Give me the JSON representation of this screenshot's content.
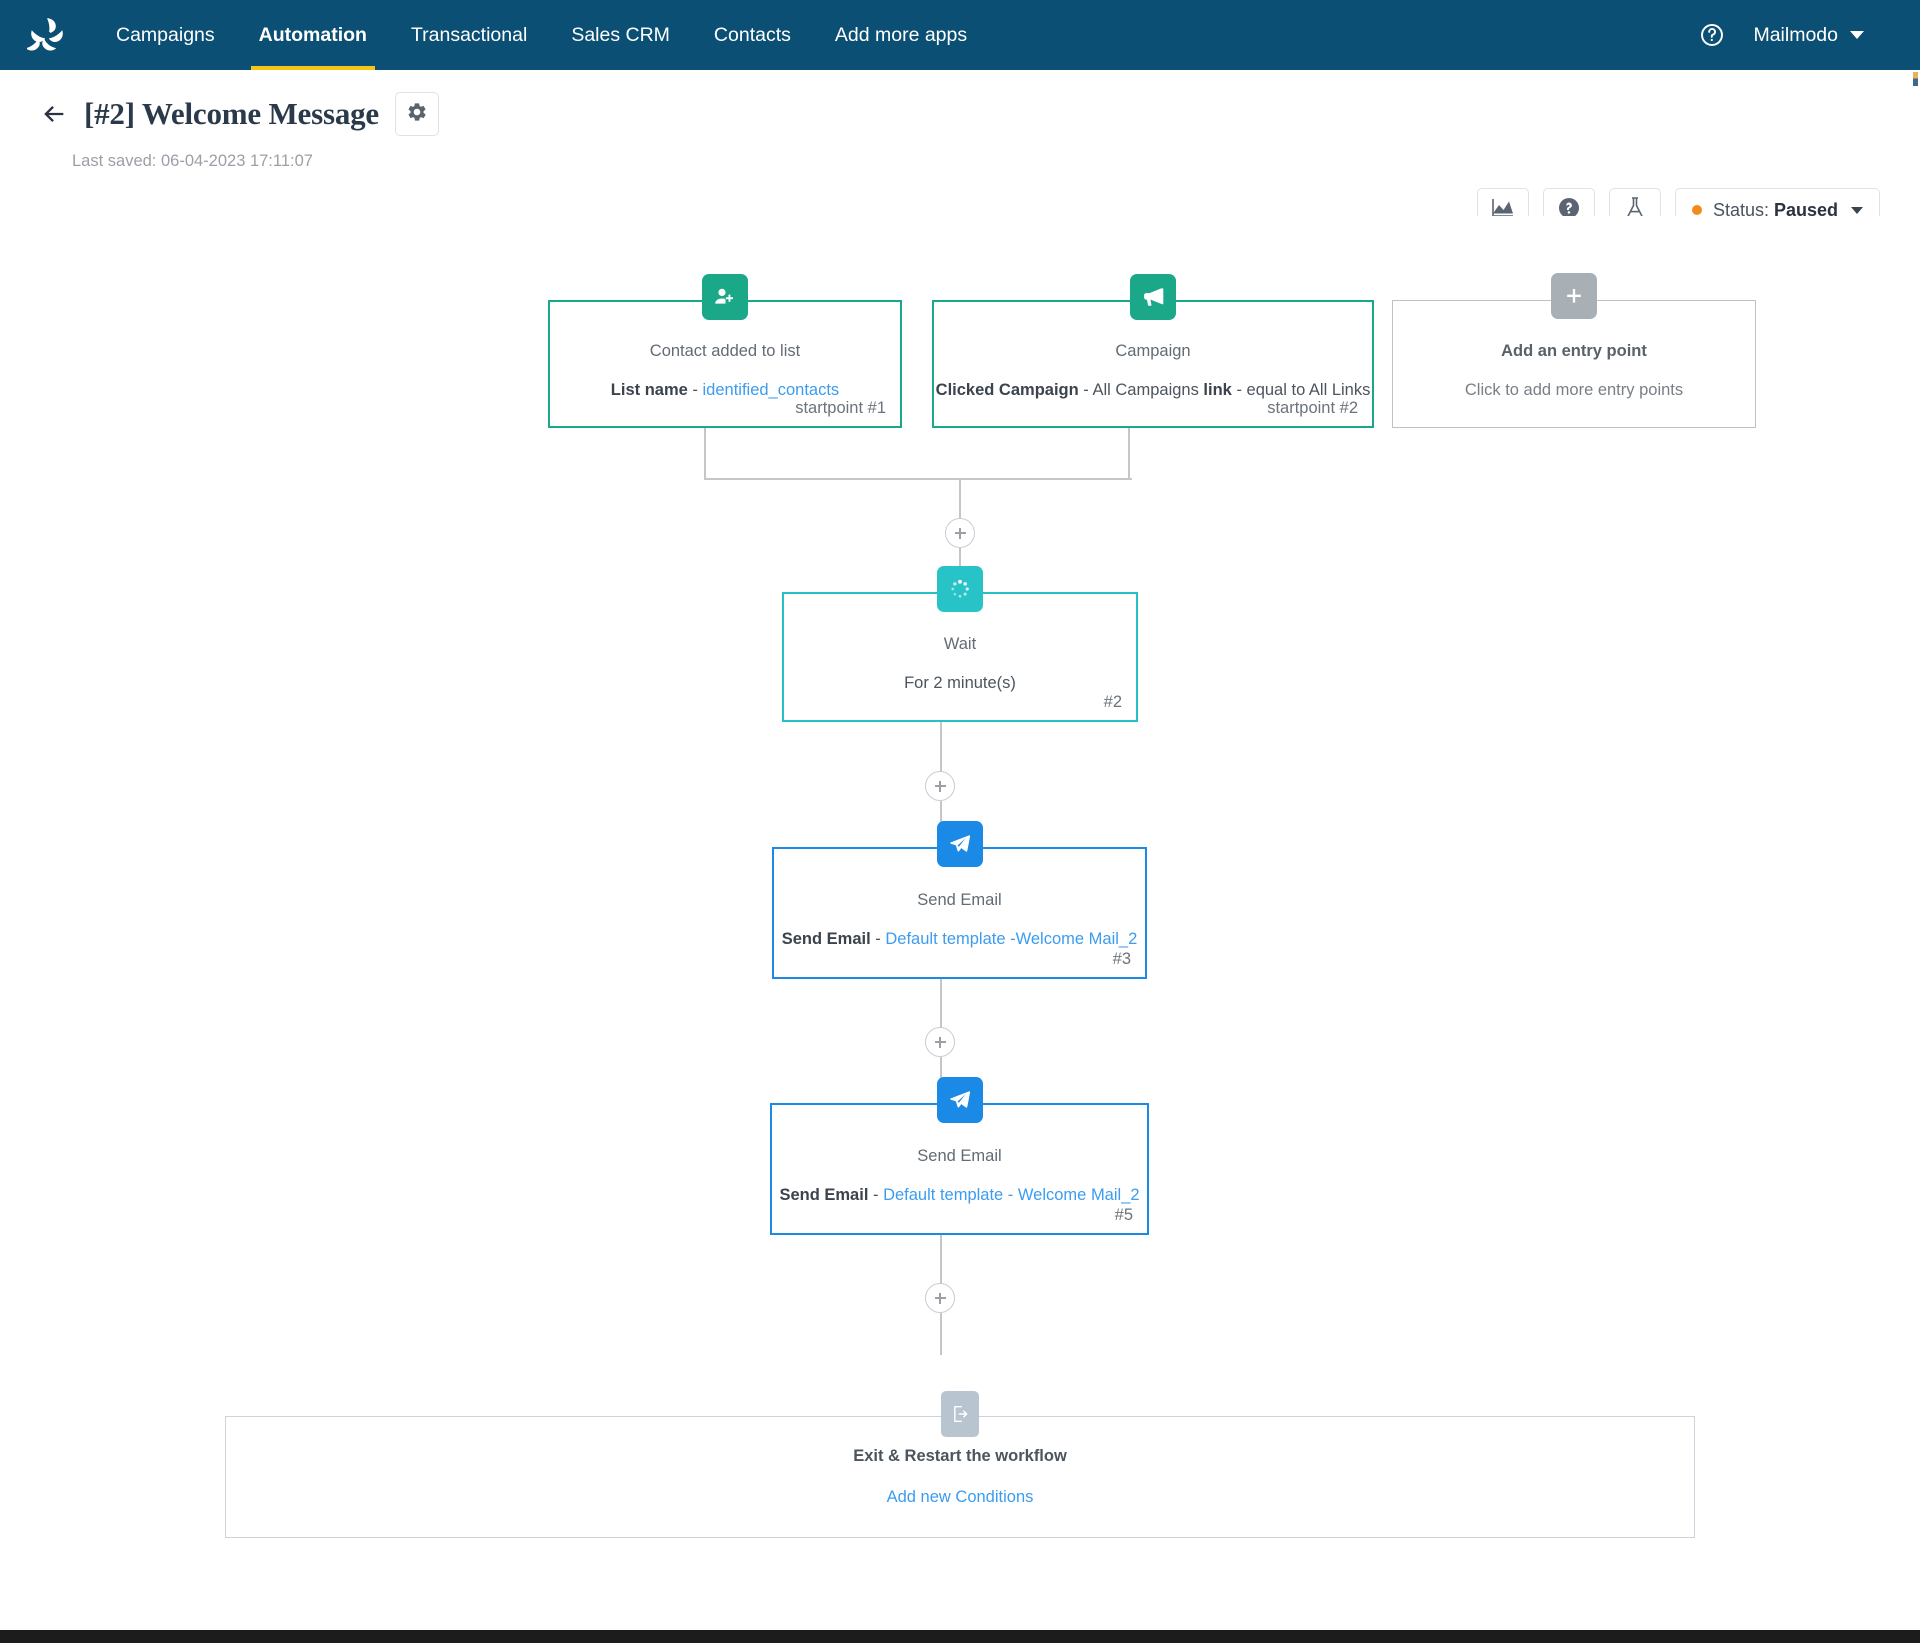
{
  "navbar": {
    "logo_icon": "mailmodo-pinwheel-logo",
    "links": [
      {
        "label": "Campaigns",
        "active": false
      },
      {
        "label": "Automation",
        "active": true
      },
      {
        "label": "Transactional",
        "active": false
      },
      {
        "label": "Sales CRM",
        "active": false
      },
      {
        "label": "Contacts",
        "active": false
      },
      {
        "label": "Add more apps",
        "active": false
      }
    ],
    "help_icon": "help-circle-icon",
    "account_label": "Mailmodo",
    "account_caret_icon": "chevron-down-icon",
    "bg_color": "#0b4f74",
    "active_underline_color": "#f5c518"
  },
  "header": {
    "back_icon": "arrow-left-icon",
    "title": "[#2] Welcome Message",
    "settings_icon": "gear-icon",
    "last_saved": "Last saved: 06-04-2023 17:11:07",
    "actions": [
      {
        "name": "analytics-button",
        "icon": "chart-area-icon"
      },
      {
        "name": "help-button",
        "icon": "question-circle-icon"
      },
      {
        "name": "ab-test-button",
        "icon": "flask-icon"
      }
    ],
    "status": {
      "prefix": "Status: ",
      "value": "Paused",
      "dot_color": "#f08b1d",
      "caret_icon": "caret-down-icon"
    }
  },
  "workflow": {
    "startpoints": [
      {
        "icon": "user-plus-icon",
        "title": "Contact added to list",
        "sub_label": "List name",
        "sub_sep": " - ",
        "sub_link": "identified_contacts",
        "index": "startpoint #1",
        "accent": "#18a88a"
      },
      {
        "icon": "megaphone-icon",
        "title": "Campaign",
        "sub_bold_1": "Clicked Campaign",
        "sub_mid": " - All Campaigns ",
        "sub_bold_2": "link",
        "sub_tail": " - equal to All Links",
        "index": "startpoint #2",
        "accent": "#18a88a"
      }
    ],
    "add_entry": {
      "icon": "plus-icon",
      "title": "Add an entry point",
      "sub": "Click to add more entry points",
      "accent": "#a9b0b5"
    },
    "steps": [
      {
        "type": "wait",
        "icon": "spinner-icon",
        "title": "Wait",
        "sub": "For 2 minute(s)",
        "index": "#2",
        "accent": "#25c1c6"
      },
      {
        "type": "send-email",
        "icon": "paper-plane-icon",
        "title": "Send Email",
        "sub_bold": "Send Email",
        "sub_sep": " - ",
        "sub_link": "Default template -Welcome Mail_2",
        "index": "#3",
        "accent": "#1a8ae6"
      },
      {
        "type": "send-email",
        "icon": "paper-plane-icon",
        "title": "Send Email",
        "sub_bold": "Send Email",
        "sub_sep": " - ",
        "sub_link": "Default template - Welcome Mail_2",
        "index": "#5",
        "accent": "#1a8ae6"
      }
    ],
    "exit": {
      "icon": "exit-door-icon",
      "label": "Exit & Restart the workflow",
      "link": "Add new Conditions"
    },
    "add_step_buttons": [
      {
        "name": "add-step-after-startpoints",
        "icon": "plus-icon"
      },
      {
        "name": "add-step-after-wait",
        "icon": "plus-icon"
      },
      {
        "name": "add-step-after-email-3",
        "icon": "plus-icon"
      },
      {
        "name": "add-step-after-email-5",
        "icon": "plus-icon"
      }
    ]
  }
}
